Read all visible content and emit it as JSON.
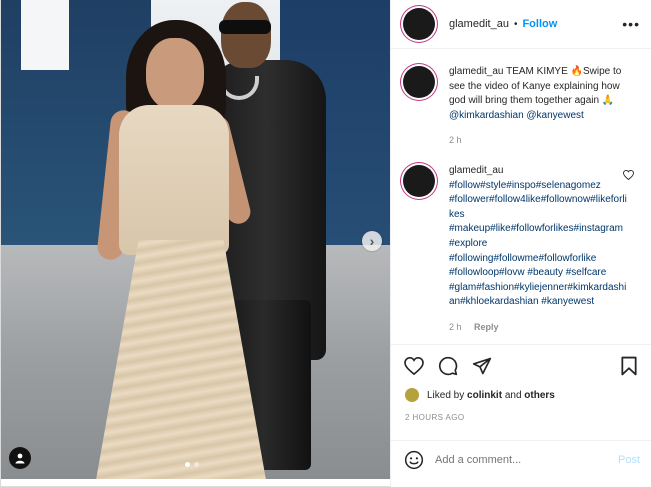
{
  "post": {
    "username": "glamedit_au",
    "separator": "•",
    "follow_label": "Follow",
    "more_label": "•••",
    "caption": {
      "username": "glamedit_au",
      "text": "TEAM KIMYE 🔥Swipe to see the video of Kanye explaining how god will bring them together again 🙏",
      "mentions": "@kimkardashian @kanyewest",
      "time": "2 h"
    },
    "comment": {
      "username": "glamedit_au",
      "text": "#follow#style#inspo#selenagomez #follower#follow4like#follownow#likeforlikes #makeup#like#followforlikes#instagram #explore #following#followme#followforlike #followloop#lovw #beauty #selfcare #glam#fashion#kyliejenner#kimkardashian#khloekardashian #kanyewest",
      "time": "2 h",
      "reply_label": "Reply"
    },
    "likes": {
      "prefix": "Liked by",
      "user": "colinkit",
      "and": "and",
      "others": "others"
    },
    "timestamp": "2 HOURS AGO",
    "add_comment_placeholder": "Add a comment...",
    "post_label": "Post",
    "carousel_next": "›"
  },
  "icons": {
    "like": "heart-icon",
    "comment": "comment-icon",
    "share": "paper-plane-icon",
    "save": "bookmark-icon",
    "emoji": "emoji-icon",
    "tag": "user-tag-icon",
    "next": "chevron-right-icon"
  },
  "colors": {
    "accent": "#0095f6",
    "link": "#00376b",
    "muted": "#8e8e8e",
    "post_disabled": "#b2dffc"
  }
}
